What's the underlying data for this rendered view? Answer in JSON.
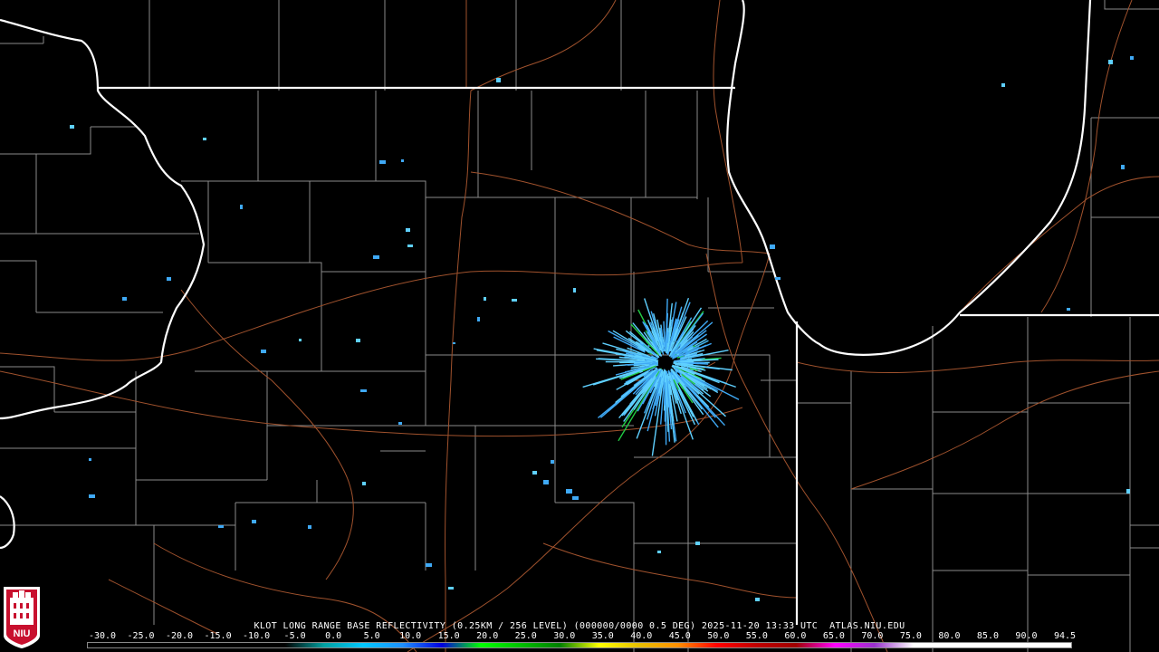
{
  "caption": {
    "text": "KLOT LONG RANGE BASE REFLECTIVITY (0.25KM / 256 LEVEL) (000000/0000 0.5 DEG) 2025-11-20 13:33 UTC  ATLAS.NIU.EDU"
  },
  "colorbar": {
    "ticks": [
      "-30.0",
      "-25.0",
      "-20.0",
      "-15.0",
      "-10.0",
      "-5.0",
      "0.0",
      "5.0",
      "10.0",
      "15.0",
      "20.0",
      "25.0",
      "30.0",
      "35.0",
      "40.0",
      "45.0",
      "50.0",
      "55.0",
      "60.0",
      "65.0",
      "70.0",
      "75.0",
      "80.0",
      "85.0",
      "90.0",
      "94.5"
    ],
    "stops": [
      "#000000",
      "#000000",
      "#000000",
      "#000000",
      "#000000",
      "#000000",
      "#00a0a0",
      "#00c8ff",
      "#1e90ff",
      "#0000e0",
      "#00ff00",
      "#00c000",
      "#008000",
      "#ffff00",
      "#e6c000",
      "#ff9000",
      "#ff0000",
      "#c00000",
      "#a00000",
      "#ff00ff",
      "#9932cc",
      "#ffffff",
      "#ffffff",
      "#ffffff",
      "#ffffff",
      "#ffffff"
    ]
  },
  "logo": {
    "text": "NIU",
    "accent": "#c8102e"
  },
  "colors": {
    "state_border": "#ffffff",
    "county_border": "#8a8a8a",
    "highway": "#a0522d",
    "echo_light": "#3fa9f5",
    "echo_cyan": "#5fd0ff",
    "echo_green": "#22cc44"
  }
}
